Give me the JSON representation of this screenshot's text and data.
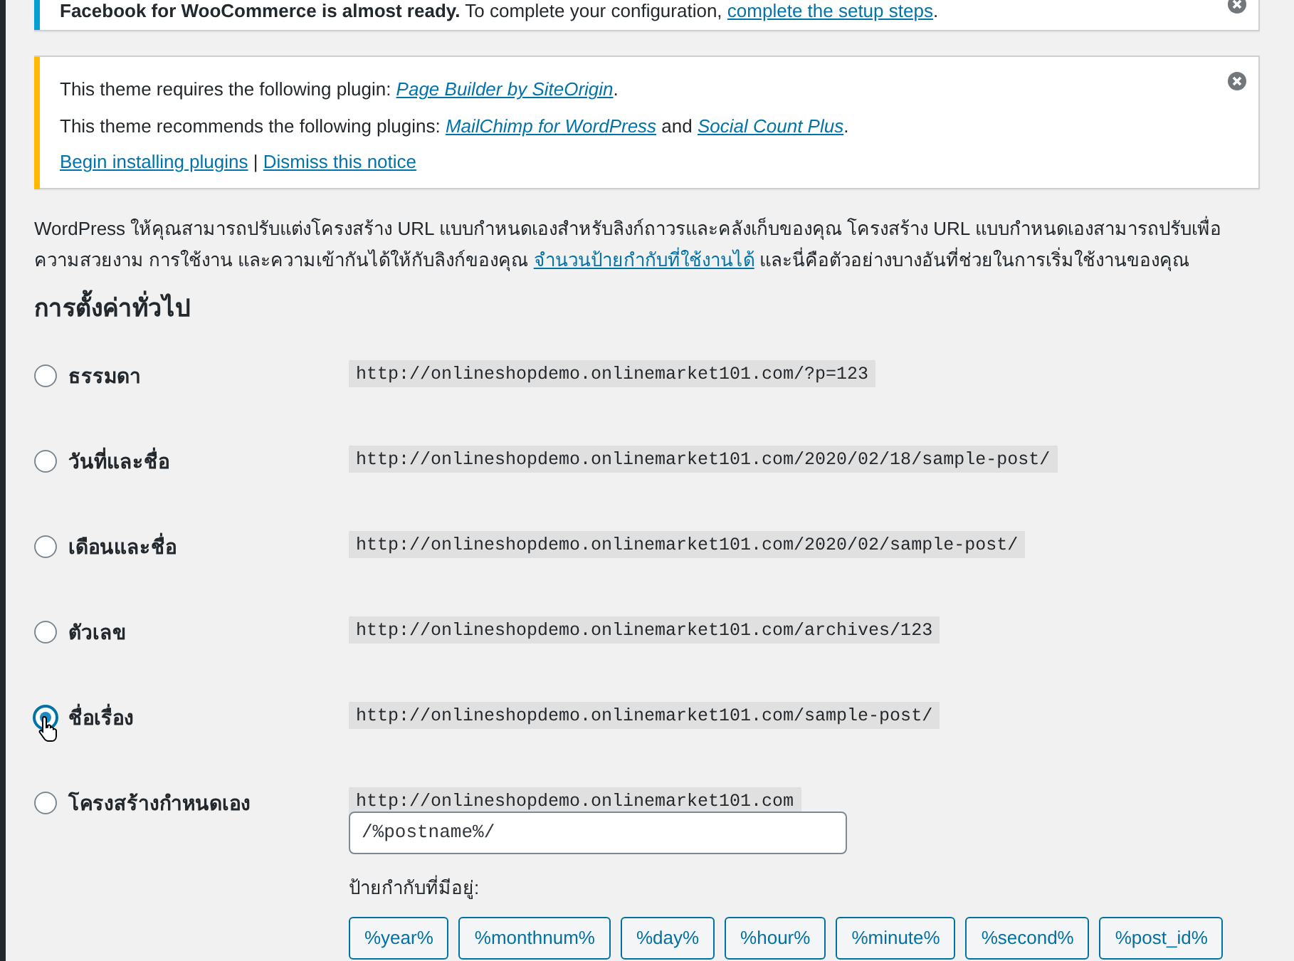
{
  "notices": [
    {
      "color": "#00a0d2",
      "dismissible": true,
      "lines": [
        [
          {
            "kind": "bold",
            "text": "Facebook for WooCommerce is almost ready."
          },
          {
            "kind": "text",
            "text": " To complete your configuration, "
          },
          {
            "kind": "link",
            "text": "complete the setup steps"
          },
          {
            "kind": "text",
            "text": "."
          }
        ]
      ]
    },
    {
      "color": "#ffb900",
      "dismissible": true,
      "lines": [
        [
          {
            "kind": "text",
            "text": "This theme requires the following plugin: "
          },
          {
            "kind": "italic-link",
            "text": "Page Builder by SiteOrigin"
          },
          {
            "kind": "text",
            "text": "."
          }
        ],
        [
          {
            "kind": "text",
            "text": "This theme recommends the following plugins: "
          },
          {
            "kind": "italic-link",
            "text": "MailChimp for WordPress"
          },
          {
            "kind": "text",
            "text": " and "
          },
          {
            "kind": "italic-link",
            "text": "Social Count Plus"
          },
          {
            "kind": "text",
            "text": "."
          }
        ],
        [
          {
            "kind": "link",
            "text": "Begin installing plugins"
          },
          {
            "kind": "text",
            "text": " | "
          },
          {
            "kind": "link",
            "text": "Dismiss this notice"
          }
        ]
      ]
    }
  ],
  "intro": [
    {
      "kind": "text",
      "text": "WordPress ให้คุณสามารถปรับแต่งโครงสร้าง URL แบบกำหนดเองสำหรับลิงก์ถาวรและคลังเก็บของคุณ โครงสร้าง URL แบบกำหนดเองสามารถปรับเพื่อความสวยงาม การใช้งาน และความเข้ากันได้ให้กับลิงก์ของคุณ "
    },
    {
      "kind": "link",
      "text": "จำนวนป้ายกำกับที่ใช้งานได้"
    },
    {
      "kind": "text",
      "text": " และนี่คือตัวอย่างบางอันที่ช่วยในการเริ่มใช้งานของคุณ"
    }
  ],
  "heading": "การตั้งค่าทั่วไป",
  "options": [
    {
      "label": "ธรรมดา",
      "example": "http://onlineshopdemo.onlinemarket101.com/?p=123",
      "selected": false
    },
    {
      "label": "วันที่และชื่อ",
      "example": "http://onlineshopdemo.onlinemarket101.com/2020/02/18/sample-post/",
      "selected": false
    },
    {
      "label": "เดือนและชื่อ",
      "example": "http://onlineshopdemo.onlinemarket101.com/2020/02/sample-post/",
      "selected": false
    },
    {
      "label": "ตัวเลข",
      "example": "http://onlineshopdemo.onlinemarket101.com/archives/123",
      "selected": false
    },
    {
      "label": "ชื่อเรื่อง",
      "example": "http://onlineshopdemo.onlinemarket101.com/sample-post/",
      "selected": true,
      "cursor": true
    },
    {
      "label": "โครงสร้างกำหนดเอง",
      "example": "http://onlineshopdemo.onlinemarket101.com",
      "selected": false,
      "custom": {
        "value": "/%postname%/",
        "tags_label": "ป้ายกำกับที่มีอยู่:",
        "tags": [
          "%year%",
          "%monthnum%",
          "%day%",
          "%hour%",
          "%minute%",
          "%second%",
          "%post_id%"
        ]
      }
    }
  ]
}
